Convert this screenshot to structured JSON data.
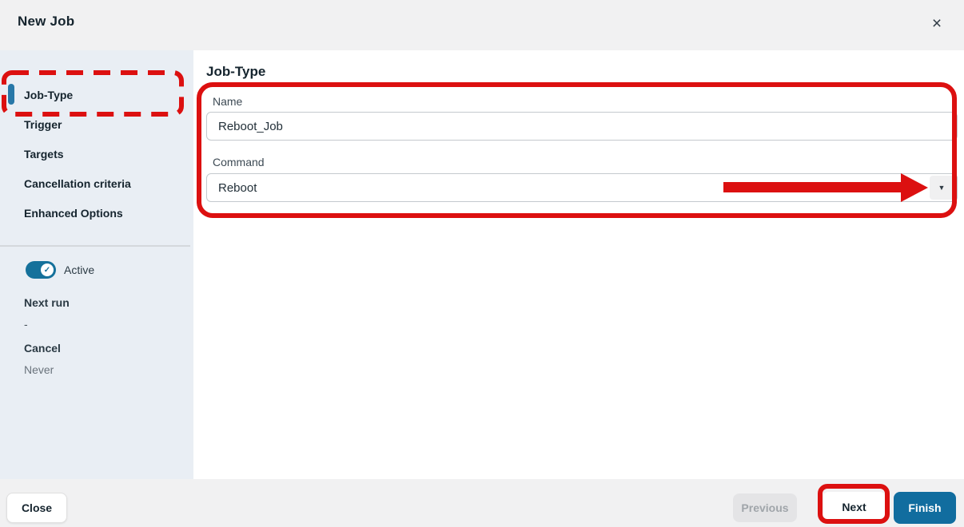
{
  "dialog": {
    "title": "New Job",
    "close_icon": "×"
  },
  "sidebar": {
    "items": [
      {
        "label": "Job-Type",
        "active": true
      },
      {
        "label": "Trigger",
        "active": false
      },
      {
        "label": "Targets",
        "active": false
      },
      {
        "label": "Cancellation criteria",
        "active": false
      },
      {
        "label": "Enhanced Options",
        "active": false
      }
    ],
    "status": {
      "toggle_label": "Active",
      "toggle_state": "on",
      "toggle_check": "✓",
      "next_run_label": "Next run",
      "next_run_value": "-",
      "cancel_label": "Cancel",
      "cancel_value": "Never"
    }
  },
  "main": {
    "heading": "Job-Type",
    "fields": {
      "name_label": "Name",
      "name_value": "Reboot_Job",
      "command_label": "Command",
      "command_value": "Reboot",
      "command_caret": "▼"
    }
  },
  "footer": {
    "close_label": "Close",
    "previous_label": "Previous",
    "next_label": "Next",
    "finish_label": "Finish"
  },
  "colors": {
    "annotation_red": "#dc1010",
    "active_indicator_blue": "#2878a8",
    "toggle_teal": "#15719b",
    "finish_button_blue": "#116d9f",
    "sidebar_bg": "#e9eef4",
    "header_footer_bg": "#f1f1f2"
  }
}
